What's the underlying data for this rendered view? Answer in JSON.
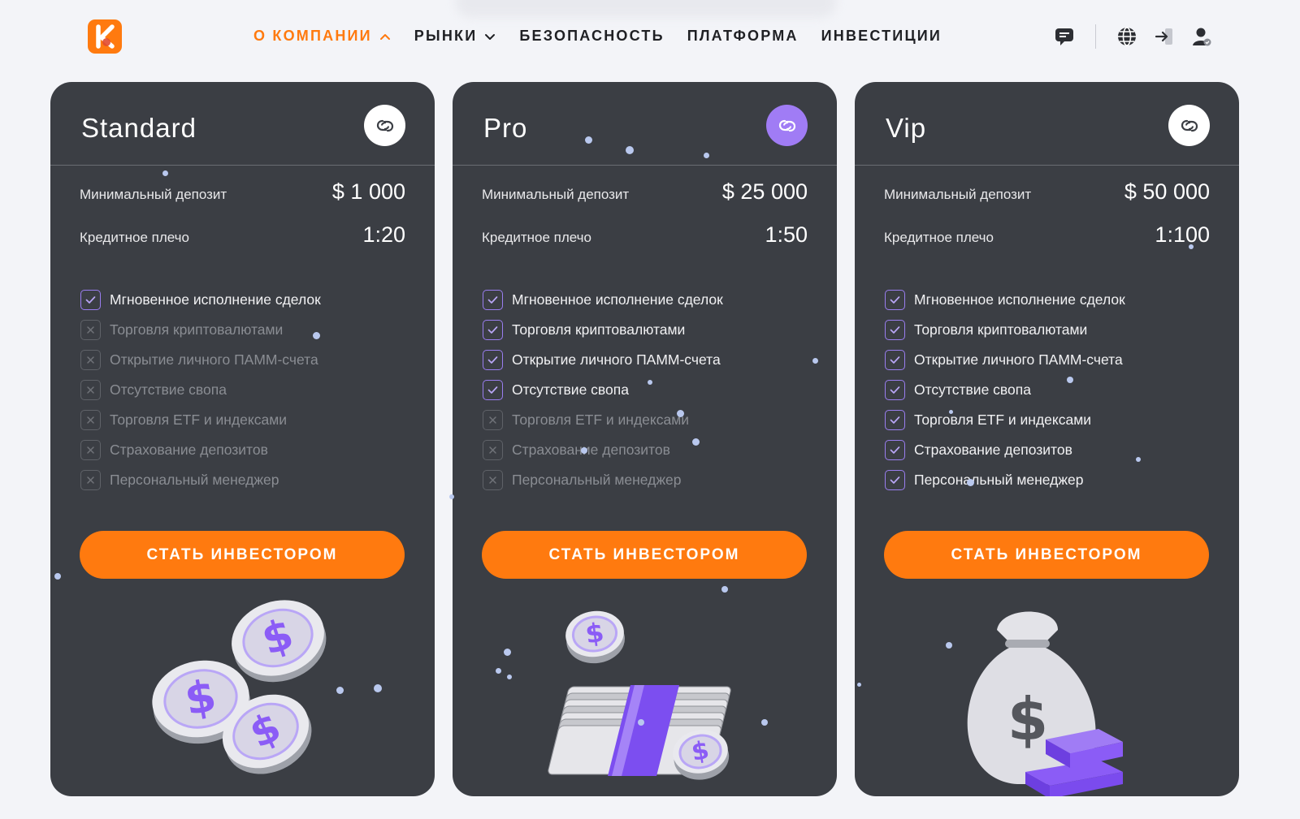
{
  "header": {
    "logo_icon": "brand-logo-icon",
    "nav": [
      {
        "label": "О КОМПАНИИ",
        "has_chevron": true,
        "chevron": "up",
        "active": true
      },
      {
        "label": "РЫНКИ",
        "has_chevron": true,
        "chevron": "down",
        "active": false
      },
      {
        "label": "БЕЗОПАСНОСТЬ",
        "has_chevron": false,
        "active": false
      },
      {
        "label": "ПЛАТФОРМА",
        "has_chevron": false,
        "active": false
      },
      {
        "label": "ИНВЕСТИЦИИ",
        "has_chevron": false,
        "active": false
      }
    ],
    "icons": [
      "chat-icon",
      "globe-icon",
      "login-icon",
      "user-icon"
    ]
  },
  "colors": {
    "accent": "#ff7a0f",
    "card_bg": "#3b3e44",
    "check_purple": "#9a7ef0",
    "page_bg": "#f3f4f8"
  },
  "labels": {
    "min_deposit": "Минимальный депозит",
    "leverage": "Кредитное плечо",
    "cta": "СТАТЬ ИНВЕСТОРОМ"
  },
  "features": [
    "Мгновенное исполнение сделок",
    "Торговля криптовалютами",
    "Открытие личного ПАММ-счета",
    "Отсутствие свопа",
    "Торговля ETF и индексами",
    "Страхование депозитов",
    "Персональный менеджер"
  ],
  "plans": [
    {
      "name": "Standard",
      "deposit": "$ 1 000",
      "leverage": "1:20",
      "badge": "white",
      "enabled": [
        true,
        false,
        false,
        false,
        false,
        false,
        false
      ],
      "illustration": "coins-illustration"
    },
    {
      "name": "Pro",
      "deposit": "$ 25 000",
      "leverage": "1:50",
      "badge": "purple",
      "enabled": [
        true,
        true,
        true,
        true,
        false,
        false,
        false
      ],
      "illustration": "cash-stack-illustration"
    },
    {
      "name": "Vip",
      "deposit": "$ 50 000",
      "leverage": "1:100",
      "badge": "white",
      "enabled": [
        true,
        true,
        true,
        true,
        true,
        true,
        true
      ],
      "illustration": "money-bag-illustration"
    }
  ]
}
